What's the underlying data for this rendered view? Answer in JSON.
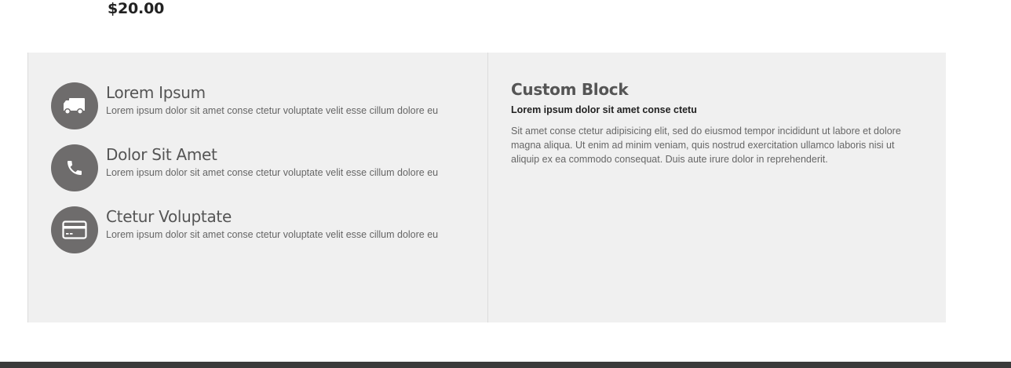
{
  "product": {
    "price": "$20.00"
  },
  "features": [
    {
      "icon": "truck-icon",
      "title": "Lorem Ipsum",
      "text": "Lorem ipsum dolor sit amet conse ctetur voluptate velit esse cillum dolore eu"
    },
    {
      "icon": "phone-icon",
      "title": "Dolor Sit Amet",
      "text": "Lorem ipsum dolor sit amet conse ctetur voluptate velit esse cillum dolore eu"
    },
    {
      "icon": "credit-card-icon",
      "title": "Ctetur Voluptate",
      "text": "Lorem ipsum dolor sit amet conse ctetur voluptate velit esse cillum dolore eu"
    }
  ],
  "custom_block": {
    "title": "Custom Block",
    "subtitle": "Lorem ipsum dolor sit amet conse ctetu",
    "body": "Sit amet conse ctetur adipisicing elit, sed do eiusmod tempor incididunt ut labore et dolore magna aliqua. Ut enim ad minim veniam, quis nostrud exercitation ullamco laboris nisi ut aliquip ex ea commodo consequat. Duis aute irure dolor in reprehenderit."
  },
  "colors": {
    "panel_background": "#f0f0f0",
    "icon_circle": "#6e6c6c",
    "footer_bar": "#3a3a3a"
  }
}
